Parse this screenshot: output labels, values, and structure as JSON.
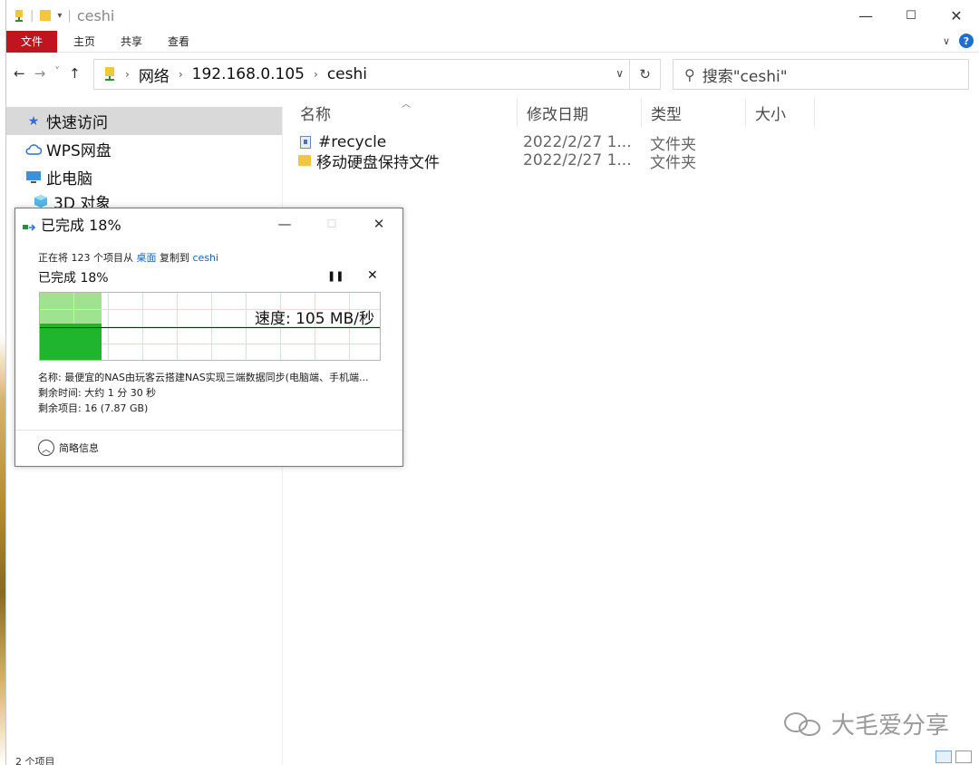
{
  "window": {
    "title": "ceshi",
    "minimize": "—",
    "maximize": "☐",
    "close": "✕"
  },
  "ribbon": {
    "tabs": [
      "文件",
      "主页",
      "共享",
      "查看"
    ],
    "expand": "∨",
    "help": "?"
  },
  "nav": {
    "back": "←",
    "forward": "→",
    "recent": "˅",
    "up": "↑"
  },
  "address": {
    "crumbs": [
      "网络",
      "192.168.0.105",
      "ceshi"
    ],
    "dropdown": "∨",
    "refresh": "↻"
  },
  "search": {
    "placeholder": "搜索\"ceshi\""
  },
  "navpane": {
    "items": [
      {
        "label": "快速访问",
        "icon": "star-icon"
      },
      {
        "label": "WPS网盘",
        "icon": "cloud-icon"
      },
      {
        "label": "此电脑",
        "icon": "computer-icon"
      },
      {
        "label": "3D 对象",
        "icon": "cube-icon"
      }
    ]
  },
  "columns": [
    "名称",
    "修改日期",
    "类型",
    "大小"
  ],
  "files": [
    {
      "name": "#recycle",
      "date": "2022/2/27 1...",
      "type": "文件夹",
      "icon": "recycle-folder-icon"
    },
    {
      "name": "移动硬盘保持文件",
      "date": "2022/2/27 1...",
      "type": "文件夹",
      "icon": "folder-icon"
    }
  ],
  "status": {
    "count": "2 个项目"
  },
  "dialog": {
    "title": "已完成 18%",
    "line_prefix": "正在将 123 个项目从",
    "source": "桌面",
    "line_mid": "复制到",
    "dest": "ceshi",
    "progress_label": "已完成 18%",
    "pause": "❚❚",
    "stop": "✕",
    "speed": "速度: 105 MB/秒",
    "progress": 0.18,
    "info_name": "名称: 最便宜的NAS由玩客云搭建NAS实现三端数据同步(电脑端、手机端...",
    "info_time": "剩余时间: 大约 1 分 30 秒",
    "info_items": "剩余项目: 16 (7.87 GB)",
    "less_details": "简略信息",
    "minimize": "—",
    "maximize": "☐",
    "close": "✕"
  },
  "watermark": {
    "text": "大毛爱分享"
  },
  "colors": {
    "file_tab": "#c0141f",
    "graph_fill": "#1fb52e",
    "graph_done": "#9fe28f",
    "link": "#1a63b8"
  }
}
